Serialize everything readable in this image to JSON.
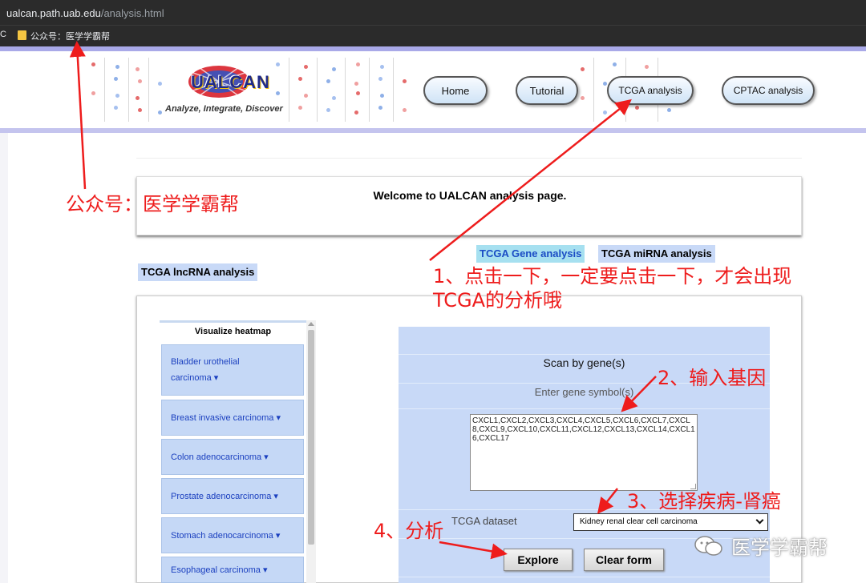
{
  "browser": {
    "url_host": "ualcan.path.uab.edu",
    "url_path": "/analysis.html",
    "bookmark_c": "C",
    "bookmark_folder": "公众号：医学学霸帮"
  },
  "header": {
    "logo_text": "UALCAN",
    "tagline": "Analyze, Integrate, Discover",
    "nav": [
      "Home",
      "Tutorial",
      "TCGA analysis",
      "CPTAC analysis"
    ]
  },
  "welcome": "Welcome to UALCAN analysis page.",
  "tabs": {
    "gene": "TCGA Gene analysis",
    "mirna": "TCGA miRNA analysis",
    "lncrna": "TCGA lncRNA analysis"
  },
  "heatmap": {
    "title": "Visualize heatmap",
    "items": [
      "Bladder urothelial carcinoma ▾",
      "Breast invasive carcinoma ▾",
      "Colon adenocarcinoma ▾",
      "Prostate adenocarcinoma ▾",
      "Stomach adenocarcinoma ▾",
      "Esophageal carcinoma ▾"
    ]
  },
  "form": {
    "title": "Scan by gene(s)",
    "enter_label": "Enter gene symbol(s)",
    "genes": "CXCL1,CXCL2,CXCL3,CXCL4,CXCL5,CXCL6,CXCL7,CXCL8,CXCL9,CXCL10,CXCL11,CXCL12,CXCL13,CXCL14,CXCL16,CXCL17",
    "dataset_label": "TCGA dataset",
    "dataset_value": "Kidney renal clear cell carcinoma",
    "explore": "Explore",
    "clear": "Clear form"
  },
  "annotations": {
    "account": "公众号：医学学霸帮",
    "step1_line1": "1、点击一下，一定要点击一下，才会出现",
    "step1_line2": "TCGA的分析哦",
    "step2": "2、输入基因",
    "step3": "3、选择疾病-肾癌",
    "step4": "4、分析",
    "watermark": "医学学霸帮"
  },
  "colors": {
    "annotation_red": "#ee1c1c",
    "gene_tab_bg": "#a6e0f0",
    "tab_bg": "#c8d9f7",
    "form_bg": "#c8d9f7"
  }
}
